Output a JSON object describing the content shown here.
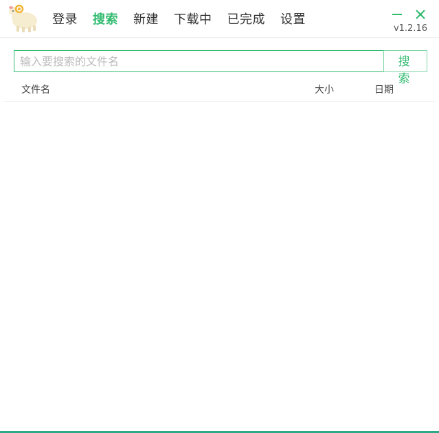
{
  "nav": {
    "items": [
      {
        "label": "登录",
        "active": false
      },
      {
        "label": "搜索",
        "active": true
      },
      {
        "label": "新建",
        "active": false
      },
      {
        "label": "下载中",
        "active": false
      },
      {
        "label": "已完成",
        "active": false
      },
      {
        "label": "设置",
        "active": false
      }
    ]
  },
  "window": {
    "version": "v1.2.16",
    "minimize_icon": "minimize-icon",
    "close_icon": "close-icon"
  },
  "search": {
    "placeholder": "输入要搜索的文件名",
    "value": "",
    "button_label": "搜 索"
  },
  "table": {
    "columns": [
      "文件名",
      "大小",
      "日期"
    ],
    "rows": []
  },
  "colors": {
    "accent": "#2fba6e",
    "bottom_bar": "#2fa88a"
  }
}
